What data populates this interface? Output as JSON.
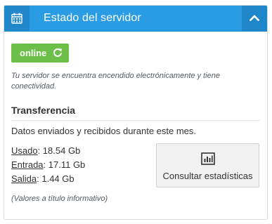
{
  "header": {
    "title": "Estado del servidor",
    "icon": "calendar-icon",
    "collapse_icon": "chevron-up-icon",
    "color": "#2a9ce3"
  },
  "status": {
    "label": "online",
    "icon": "refresh-icon",
    "color": "#6cc04a"
  },
  "status_description": "Tu servidor se encuentra encendido electrónicamente y tiene conectividad.",
  "transfer": {
    "title": "Transferencia",
    "description": "Datos enviados y recibidos durante este mes.",
    "stats": [
      {
        "label": "Usado",
        "value": ": 18.54 Gb"
      },
      {
        "label": "Entrada",
        "value": ": 17.11 Gb"
      },
      {
        "label": "Salida",
        "value": ": 1.44 Gb"
      }
    ],
    "note": "(Valores a título informativo)",
    "button_label": "Consultar estadísticas",
    "button_icon": "bar-chart-icon"
  }
}
